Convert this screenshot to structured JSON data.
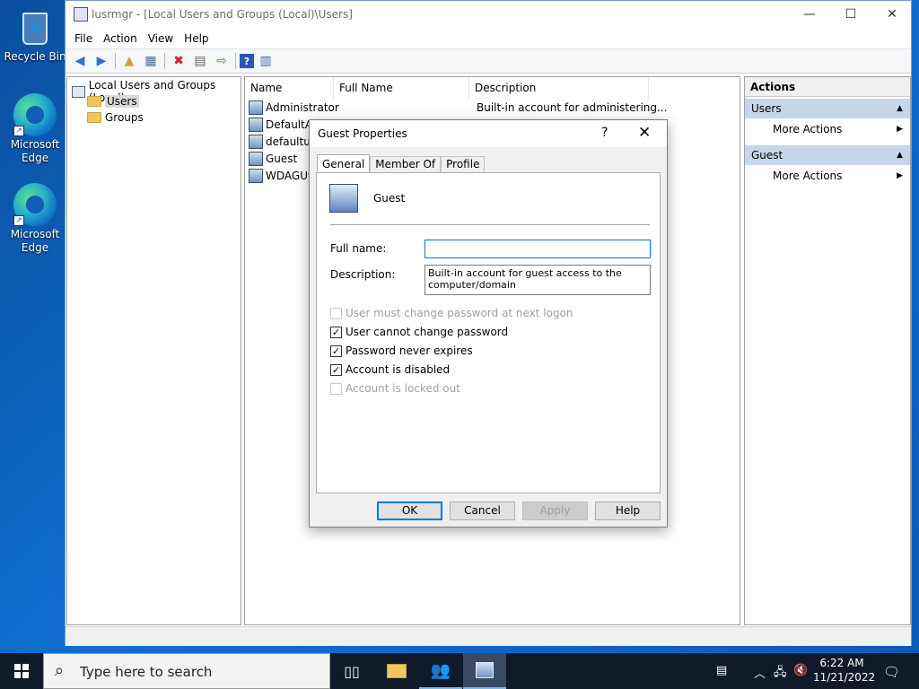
{
  "desktop": {
    "icons": [
      {
        "label": "Recycle Bin"
      },
      {
        "label": "Microsoft Edge"
      },
      {
        "label": "Microsoft Edge"
      }
    ]
  },
  "window": {
    "title": "lusrmgr - [Local Users and Groups (Local)\\Users]",
    "minimize": "—",
    "maximize": "☐",
    "close": "✕"
  },
  "menu": [
    "File",
    "Action",
    "View",
    "Help"
  ],
  "tree": {
    "root": "Local Users and Groups (Local)",
    "children": [
      "Users",
      "Groups"
    ]
  },
  "list": {
    "columns": [
      "Name",
      "Full Name",
      "Description"
    ],
    "rows": [
      {
        "name": "Administrator",
        "full_name": "",
        "description": "Built-in account for administering..."
      },
      {
        "name": "DefaultAc",
        "full_name": "",
        "description": ""
      },
      {
        "name": "defaultus",
        "full_name": "",
        "description": ""
      },
      {
        "name": "Guest",
        "full_name": "",
        "description": ""
      },
      {
        "name": "WDAGUti",
        "full_name": "",
        "description": ""
      }
    ]
  },
  "actions": {
    "header": "Actions",
    "groups": [
      {
        "title": "Users",
        "item": "More Actions"
      },
      {
        "title": "Guest",
        "item": "More Actions"
      }
    ]
  },
  "dialog": {
    "title": "Guest Properties",
    "help": "?",
    "close": "✕",
    "tabs": [
      "General",
      "Member Of",
      "Profile"
    ],
    "user_name": "Guest",
    "full_name_label": "Full name:",
    "full_name_value": "",
    "description_label": "Description:",
    "description_value": "Built-in account for guest access to the computer/domain",
    "checkboxes": [
      {
        "label": "User must change password at next logon",
        "checked": false,
        "enabled": false
      },
      {
        "label": "User cannot change password",
        "checked": true,
        "enabled": true
      },
      {
        "label": "Password never expires",
        "checked": true,
        "enabled": true
      },
      {
        "label": "Account is disabled",
        "checked": true,
        "enabled": true
      },
      {
        "label": "Account is locked out",
        "checked": false,
        "enabled": false
      }
    ],
    "buttons": {
      "ok": "OK",
      "cancel": "Cancel",
      "apply": "Apply",
      "help": "Help"
    }
  },
  "taskbar": {
    "search_placeholder": "Type here to search",
    "time": "6:22 AM",
    "date": "11/21/2022"
  },
  "colors": {
    "accent": "#0078d7",
    "taskbar": "#101a2b",
    "action_group": "#c7d5e8"
  }
}
